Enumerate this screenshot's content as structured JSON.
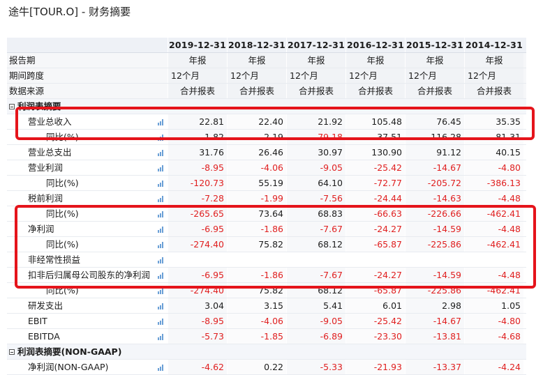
{
  "title": "途牛[TOUR.O] - 财务摘要",
  "columns": [
    "2019-12-31",
    "2018-12-31",
    "2017-12-31",
    "2016-12-31",
    "2015-12-31",
    "2014-12-31"
  ],
  "meta_rows": [
    {
      "label": "报告期",
      "values": [
        "年报",
        "年报",
        "年报",
        "年报",
        "年报",
        "年报"
      ],
      "align": "center"
    },
    {
      "label": "期间跨度",
      "values": [
        "12个月",
        "12个月",
        "12个月",
        "12个月",
        "12个月",
        "12个月"
      ],
      "align": "left"
    },
    {
      "label": "数据来源",
      "values": [
        "合并报表",
        "合并报表",
        "合并报表",
        "合并报表",
        "合并报表",
        "合并报表"
      ],
      "align": "center"
    }
  ],
  "section1": {
    "label": "利润表摘要"
  },
  "rows1": [
    {
      "label": "营业总收入",
      "level": 1,
      "values": [
        "22.81",
        "22.40",
        "21.92",
        "105.48",
        "76.45",
        "35.35"
      ]
    },
    {
      "label": "同比(%)",
      "level": 2,
      "values": [
        "1.82",
        "2.19",
        "-79.18",
        "37.51",
        "116.28",
        "81.31"
      ]
    },
    {
      "label": "营业总支出",
      "level": 1,
      "values": [
        "31.76",
        "26.46",
        "30.97",
        "130.90",
        "91.12",
        "40.15"
      ]
    },
    {
      "label": "营业利润",
      "level": 1,
      "values": [
        "-8.95",
        "-4.06",
        "-9.05",
        "-25.42",
        "-14.67",
        "-4.80"
      ]
    },
    {
      "label": "同比(%)",
      "level": 2,
      "values": [
        "-120.73",
        "55.19",
        "64.10",
        "-72.77",
        "-205.72",
        "-386.13"
      ]
    },
    {
      "label": "税前利润",
      "level": 1,
      "values": [
        "-7.28",
        "-1.99",
        "-7.56",
        "-24.44",
        "-14.63",
        "-4.48"
      ]
    },
    {
      "label": "同比(%)",
      "level": 2,
      "values": [
        "-265.65",
        "73.64",
        "68.83",
        "-66.63",
        "-226.66",
        "-462.41"
      ]
    },
    {
      "label": "净利润",
      "level": 1,
      "values": [
        "-6.95",
        "-1.86",
        "-7.67",
        "-24.27",
        "-14.59",
        "-4.48"
      ]
    },
    {
      "label": "同比(%)",
      "level": 2,
      "values": [
        "-274.40",
        "75.82",
        "68.12",
        "-65.87",
        "-225.86",
        "-462.41"
      ]
    },
    {
      "label": "非经常性损益",
      "level": 1,
      "values": [
        "",
        "",
        "",
        "",
        "",
        ""
      ]
    },
    {
      "label": "扣非后归属母公司股东的净利润",
      "level": 1,
      "values": [
        "-6.95",
        "-1.86",
        "-7.67",
        "-24.27",
        "-14.59",
        "-4.48"
      ]
    },
    {
      "label": "同比(%)",
      "level": 2,
      "values": [
        "-274.40",
        "75.82",
        "68.12",
        "-65.87",
        "-225.86",
        "-462.41"
      ]
    },
    {
      "label": "研发支出",
      "level": 1,
      "values": [
        "3.04",
        "3.15",
        "5.41",
        "6.01",
        "2.98",
        "1.05"
      ]
    },
    {
      "label": "EBIT",
      "level": 1,
      "values": [
        "-8.95",
        "-4.06",
        "-9.05",
        "-25.42",
        "-14.67",
        "-4.80"
      ]
    },
    {
      "label": "EBITDA",
      "level": 1,
      "values": [
        "-5.73",
        "-1.85",
        "-6.89",
        "-23.30",
        "-13.81",
        "-4.68"
      ]
    }
  ],
  "section2": {
    "label": "利润表摘要(NON-GAAP)"
  },
  "rows2": [
    {
      "label": "净利润(NON-GAAP)",
      "level": 1,
      "values": [
        "-4.62",
        "0.22",
        "-5.33",
        "-21.93",
        "-13.37",
        "-4.24"
      ]
    }
  ],
  "colors": {
    "negative": "#e02020",
    "highlight": "#e5141b",
    "chart_icon": "#6a9fd6"
  },
  "icons": {
    "row_chart": "bar-chart-icon",
    "section_toggle": "collapse-icon"
  }
}
